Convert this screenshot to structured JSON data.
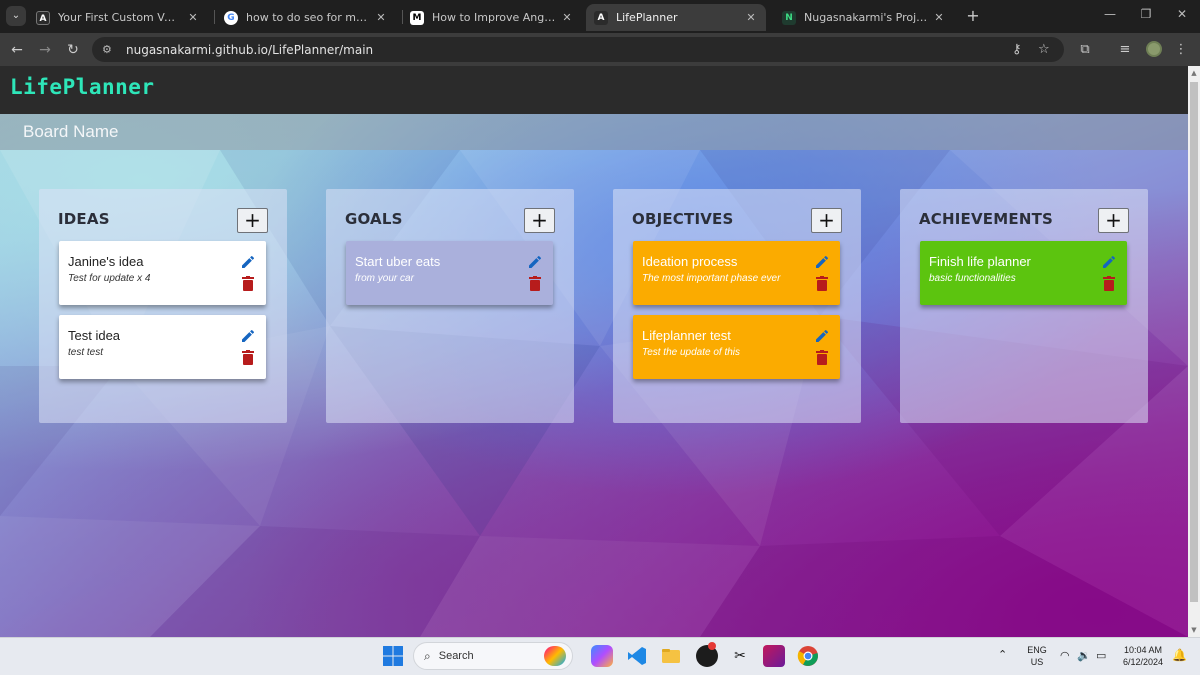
{
  "browser": {
    "tabs": [
      {
        "title": "Your First Custom Vue Compon",
        "favicon": "A"
      },
      {
        "title": "how to do seo for my website -",
        "favicon": "G"
      },
      {
        "title": "How to Improve Angular Applic",
        "favicon": "M"
      },
      {
        "title": "LifePlanner",
        "favicon": "A",
        "active": true
      },
      {
        "title": "Nugasnakarmi's Project | LifePla",
        "favicon": "N"
      }
    ],
    "url": "nugasnakarmi.github.io/LifePlanner/main"
  },
  "app": {
    "brand": "LifePlanner",
    "board_name": "Board Name"
  },
  "columns": [
    {
      "title": "IDEAS",
      "cards": [
        {
          "title": "Janine's idea",
          "description": "Test for update x 4",
          "color": "#ffffff"
        },
        {
          "title": "Test idea",
          "description": "test test",
          "color": "#ffffff"
        }
      ]
    },
    {
      "title": "GOALS",
      "cards": [
        {
          "title": "Start uber eats",
          "description": "from your car",
          "color": "#aab0dc"
        }
      ]
    },
    {
      "title": "OBJECTIVES",
      "cards": [
        {
          "title": "Ideation process",
          "description": "The most important phase ever",
          "color": "#fbab00"
        },
        {
          "title": "Lifeplanner test",
          "description": "Test the update of this",
          "color": "#fbab00"
        }
      ]
    },
    {
      "title": "ACHIEVEMENTS",
      "cards": [
        {
          "title": "Finish life planner",
          "description": "basic functionalities",
          "color": "#5cc40f"
        }
      ]
    }
  ],
  "ui": {
    "add_label": "+",
    "edit_icon_color": "#1565c0",
    "delete_icon_color": "#b71c1c"
  },
  "taskbar": {
    "search_label": "Search",
    "language": "ENG",
    "region": "US",
    "time": "10:04 AM",
    "date": "6/12/2024"
  }
}
